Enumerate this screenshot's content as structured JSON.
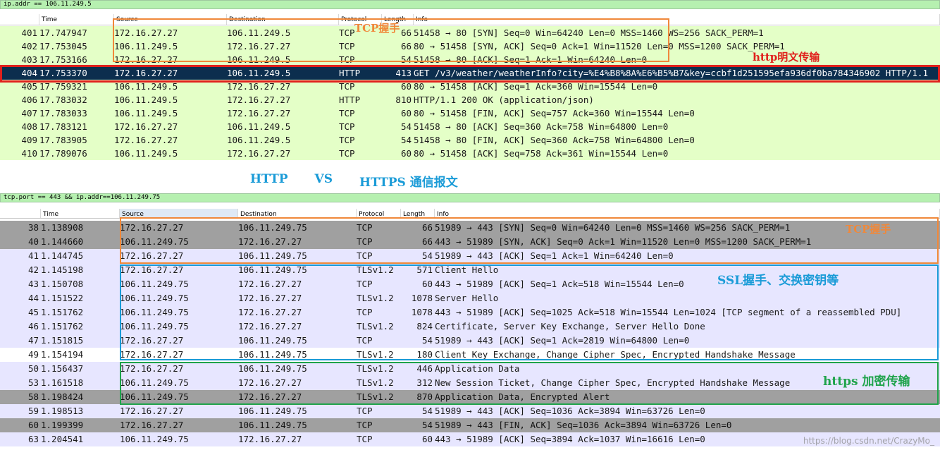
{
  "top_capture": {
    "filter": "ip.addr == 106.11.249.5",
    "columns": [
      "Time",
      "Source",
      "Destination",
      "Protocol",
      "Length",
      "Info"
    ],
    "rows": [
      {
        "no": "401",
        "time": "17.747947",
        "src": "172.16.27.27",
        "dst": "106.11.249.5",
        "proto": "TCP",
        "len": "66",
        "info": "51458 → 80 [SYN] Seq=0 Win=64240 Len=0 MSS=1460 WS=256 SACK_PERM=1",
        "style": "green"
      },
      {
        "no": "402",
        "time": "17.753045",
        "src": "106.11.249.5",
        "dst": "172.16.27.27",
        "proto": "TCP",
        "len": "66",
        "info": "80 → 51458 [SYN, ACK] Seq=0 Ack=1 Win=11520 Len=0 MSS=1200 SACK_PERM=1",
        "style": "green"
      },
      {
        "no": "403",
        "time": "17.753166",
        "src": "172.16.27.27",
        "dst": "106.11.249.5",
        "proto": "TCP",
        "len": "54",
        "info": "51458 → 80 [ACK] Seq=1 Ack=1 Win=64240 Len=0",
        "style": "green"
      },
      {
        "no": "404",
        "time": "17.753370",
        "src": "172.16.27.27",
        "dst": "106.11.249.5",
        "proto": "HTTP",
        "len": "413",
        "info": "GET /v3/weather/weatherInfo?city=%E4%B8%8A%E6%B5%B7&key=ccbf1d251595efa936df0ba784346902 HTTP/1.1",
        "style": "selected"
      },
      {
        "no": "405",
        "time": "17.759321",
        "src": "106.11.249.5",
        "dst": "172.16.27.27",
        "proto": "TCP",
        "len": "60",
        "info": "80 → 51458 [ACK] Seq=1 Ack=360 Win=15544 Len=0",
        "style": "green"
      },
      {
        "no": "406",
        "time": "17.783032",
        "src": "106.11.249.5",
        "dst": "172.16.27.27",
        "proto": "HTTP",
        "len": "810",
        "info": "HTTP/1.1 200 OK  (application/json)",
        "style": "green"
      },
      {
        "no": "407",
        "time": "17.783033",
        "src": "106.11.249.5",
        "dst": "172.16.27.27",
        "proto": "TCP",
        "len": "60",
        "info": "80 → 51458 [FIN, ACK] Seq=757 Ack=360 Win=15544 Len=0",
        "style": "green"
      },
      {
        "no": "408",
        "time": "17.783121",
        "src": "172.16.27.27",
        "dst": "106.11.249.5",
        "proto": "TCP",
        "len": "54",
        "info": "51458 → 80 [ACK] Seq=360 Ack=758 Win=64800 Len=0",
        "style": "green"
      },
      {
        "no": "409",
        "time": "17.783905",
        "src": "172.16.27.27",
        "dst": "106.11.249.5",
        "proto": "TCP",
        "len": "54",
        "info": "51458 → 80 [FIN, ACK] Seq=360 Ack=758 Win=64800 Len=0",
        "style": "green"
      },
      {
        "no": "410",
        "time": "17.789076",
        "src": "106.11.249.5",
        "dst": "172.16.27.27",
        "proto": "TCP",
        "len": "60",
        "info": "80 → 51458 [ACK] Seq=758 Ack=361 Win=15544 Len=0",
        "style": "green"
      }
    ]
  },
  "bottom_capture": {
    "filter": "tcp.port == 443 && ip.addr==106.11.249.75",
    "columns": [
      "Time",
      "Source",
      "Destination",
      "Protocol",
      "Length",
      "Info"
    ],
    "rows": [
      {
        "no": "38",
        "time": "1.138908",
        "src": "172.16.27.27",
        "dst": "106.11.249.75",
        "proto": "TCP",
        "len": "66",
        "info": "51989 → 443 [SYN] Seq=0 Win=64240 Len=0 MSS=1460 WS=256 SACK_PERM=1",
        "style": "gray"
      },
      {
        "no": "40",
        "time": "1.144660",
        "src": "106.11.249.75",
        "dst": "172.16.27.27",
        "proto": "TCP",
        "len": "66",
        "info": "443 → 51989 [SYN, ACK] Seq=0 Ack=1 Win=11520 Len=0 MSS=1200 SACK_PERM=1",
        "style": "gray"
      },
      {
        "no": "41",
        "time": "1.144745",
        "src": "172.16.27.27",
        "dst": "106.11.249.75",
        "proto": "TCP",
        "len": "54",
        "info": "51989 → 443 [ACK] Seq=1 Ack=1 Win=64240 Len=0",
        "style": "lav"
      },
      {
        "no": "42",
        "time": "1.145198",
        "src": "172.16.27.27",
        "dst": "106.11.249.75",
        "proto": "TLSv1.2",
        "len": "571",
        "info": "Client Hello",
        "style": "lav"
      },
      {
        "no": "43",
        "time": "1.150708",
        "src": "106.11.249.75",
        "dst": "172.16.27.27",
        "proto": "TCP",
        "len": "60",
        "info": "443 → 51989 [ACK] Seq=1 Ack=518 Win=15544 Len=0",
        "style": "lav"
      },
      {
        "no": "44",
        "time": "1.151522",
        "src": "106.11.249.75",
        "dst": "172.16.27.27",
        "proto": "TLSv1.2",
        "len": "1078",
        "info": "Server Hello",
        "style": "lav"
      },
      {
        "no": "45",
        "time": "1.151762",
        "src": "106.11.249.75",
        "dst": "172.16.27.27",
        "proto": "TCP",
        "len": "1078",
        "info": "443 → 51989 [ACK] Seq=1025 Ack=518 Win=15544 Len=1024 [TCP segment of a reassembled PDU]",
        "style": "lav"
      },
      {
        "no": "46",
        "time": "1.151762",
        "src": "106.11.249.75",
        "dst": "172.16.27.27",
        "proto": "TLSv1.2",
        "len": "824",
        "info": "Certificate, Server Key Exchange, Server Hello Done",
        "style": "lav"
      },
      {
        "no": "47",
        "time": "1.151815",
        "src": "172.16.27.27",
        "dst": "106.11.249.75",
        "proto": "TCP",
        "len": "54",
        "info": "51989 → 443 [ACK] Seq=1 Ack=2819 Win=64800 Len=0",
        "style": "lav"
      },
      {
        "no": "49",
        "time": "1.154194",
        "src": "172.16.27.27",
        "dst": "106.11.249.75",
        "proto": "TLSv1.2",
        "len": "180",
        "info": "Client Key Exchange, Change Cipher Spec, Encrypted Handshake Message",
        "style": "white"
      },
      {
        "no": "50",
        "time": "1.156437",
        "src": "172.16.27.27",
        "dst": "106.11.249.75",
        "proto": "TLSv1.2",
        "len": "446",
        "info": "Application Data",
        "style": "lav"
      },
      {
        "no": "53",
        "time": "1.161518",
        "src": "106.11.249.75",
        "dst": "172.16.27.27",
        "proto": "TLSv1.2",
        "len": "312",
        "info": "New Session Ticket, Change Cipher Spec, Encrypted Handshake Message",
        "style": "lav"
      },
      {
        "no": "58",
        "time": "1.198424",
        "src": "106.11.249.75",
        "dst": "172.16.27.27",
        "proto": "TLSv1.2",
        "len": "870",
        "info": "Application Data, Encrypted Alert",
        "style": "gray"
      },
      {
        "no": "59",
        "time": "1.198513",
        "src": "172.16.27.27",
        "dst": "106.11.249.75",
        "proto": "TCP",
        "len": "54",
        "info": "51989 → 443 [ACK] Seq=1036 Ack=3894 Win=63726 Len=0",
        "style": "lav"
      },
      {
        "no": "60",
        "time": "1.199399",
        "src": "172.16.27.27",
        "dst": "106.11.249.75",
        "proto": "TCP",
        "len": "54",
        "info": "51989 → 443 [FIN, ACK] Seq=1036 Ack=3894 Win=63726 Len=0",
        "style": "gray"
      },
      {
        "no": "63",
        "time": "1.204541",
        "src": "106.11.249.75",
        "dst": "172.16.27.27",
        "proto": "TCP",
        "len": "60",
        "info": "443 → 51989 [ACK] Seq=3894 Ack=1037 Win=16616 Len=0",
        "style": "lav"
      }
    ]
  },
  "annotations": {
    "tcp_handshake_top": "TCP握手",
    "http_plaintext": "http明文传输",
    "tcp_handshake_bottom": "TCP握手",
    "ssl_handshake": "SSL握手、交换密钥等",
    "https_encrypted": "https 加密传输"
  },
  "compare_title": {
    "left": "HTTP",
    "mid": "VS",
    "right": "HTTPS 通信报文"
  },
  "watermark": "https://blog.csdn.net/CrazyMo_",
  "colors": {
    "annotation_orange": "#f0883a",
    "annotation_red": "#e0201c",
    "annotation_blue": "#1a9bd7",
    "annotation_green": "#1fa34b",
    "row_green": "#e4ffc7",
    "row_selected": "#0c2e4e",
    "row_gray": "#a0a0a0",
    "row_lavender": "#e7e6ff",
    "filter_bar": "#b6f0b0"
  }
}
